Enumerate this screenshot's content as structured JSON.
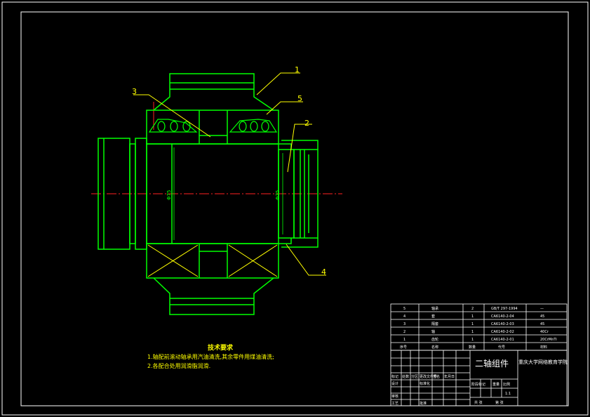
{
  "callouts": [
    "1",
    "2",
    "3",
    "4",
    "5"
  ],
  "tech_requirements": {
    "title": "技术要求",
    "lines": [
      "1.轴配前滚动轴承用汽油清洗,其余零件用煤油清洗;",
      "2.各配合处用润滑脂润滑."
    ]
  },
  "parts_list": {
    "header": [
      "序号",
      "名称",
      "数量",
      "代号",
      "材料"
    ],
    "rows": [
      [
        "5",
        "轴承",
        "2",
        "GB/T 297-1994",
        "—"
      ],
      [
        "4",
        "套",
        "1",
        "CA6140-2-04",
        "45"
      ],
      [
        "3",
        "隔套",
        "1",
        "CA6140-2-03",
        "45"
      ],
      [
        "2",
        "轴",
        "1",
        "CA6140-2-02",
        "40Cr"
      ],
      [
        "1",
        "齿轮",
        "1",
        "CA6140-2-01",
        "20CrMnTi"
      ]
    ]
  },
  "title_block": {
    "drawing_name": "二轴组件",
    "school": "重庆大学网络教育学院",
    "small_labels": [
      "标记",
      "处数",
      "分区",
      "更改文件号",
      "签名",
      "年月日",
      "设计",
      "标准化",
      "审核",
      "工艺",
      "批准",
      "阶段标记",
      "重量",
      "比例",
      "共 张",
      "第 张"
    ],
    "scale": "1:1"
  },
  "dimensions": [
    "Φ75",
    "Φ75"
  ],
  "colors": {
    "part": "#00ff00",
    "frame": "#ffffff",
    "center": "#ff2020",
    "hatch": "#ffff00",
    "text": "#ffff00"
  }
}
